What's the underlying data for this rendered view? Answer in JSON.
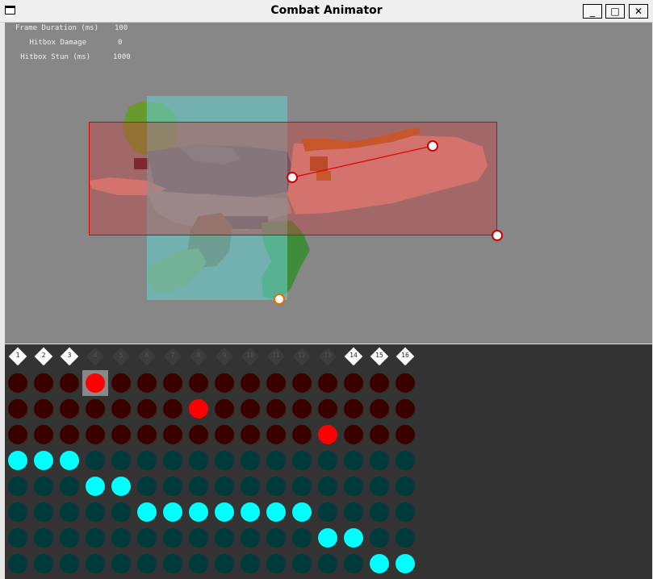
{
  "window": {
    "title": "Combat Animator",
    "min_label": "_",
    "max_label": "□",
    "close_label": "✕"
  },
  "properties": [
    {
      "label": "Frame Duration (ms)",
      "value": "100"
    },
    {
      "label": "Hitbox Damage",
      "value": "0"
    },
    {
      "label": "Hitbox Stun (ms)",
      "value": "1000"
    }
  ],
  "frames": {
    "labels": [
      "1",
      "2",
      "3",
      "4",
      "5",
      "6",
      "7",
      "8",
      "9",
      "10",
      "11",
      "12",
      "13",
      "14",
      "15",
      "16"
    ],
    "active": [
      true,
      true,
      true,
      false,
      false,
      false,
      false,
      false,
      false,
      false,
      false,
      false,
      false,
      true,
      true,
      true
    ]
  },
  "grid": {
    "selected": {
      "row": 0,
      "col": 3
    },
    "rows": [
      {
        "kind": "hit",
        "on": [
          3
        ]
      },
      {
        "kind": "hit",
        "on": [
          7
        ]
      },
      {
        "kind": "hit",
        "on": [
          12
        ]
      },
      {
        "kind": "hurt",
        "on": [
          0,
          1,
          2
        ]
      },
      {
        "kind": "hurt",
        "on": [
          3,
          4
        ]
      },
      {
        "kind": "hurt",
        "on": [
          5,
          6,
          7,
          8,
          9,
          10,
          11
        ]
      },
      {
        "kind": "hurt",
        "on": [
          12,
          13
        ]
      },
      {
        "kind": "hurt",
        "on": [
          14,
          15
        ]
      }
    ]
  },
  "colors": {
    "canvas_bg": "#878787",
    "timeline_bg": "#333333",
    "hitbox_on": "#ff0000",
    "hitbox_off": "#3a0000",
    "hurtbox_on": "#00ffff",
    "hurtbox_off": "#003a3a"
  }
}
